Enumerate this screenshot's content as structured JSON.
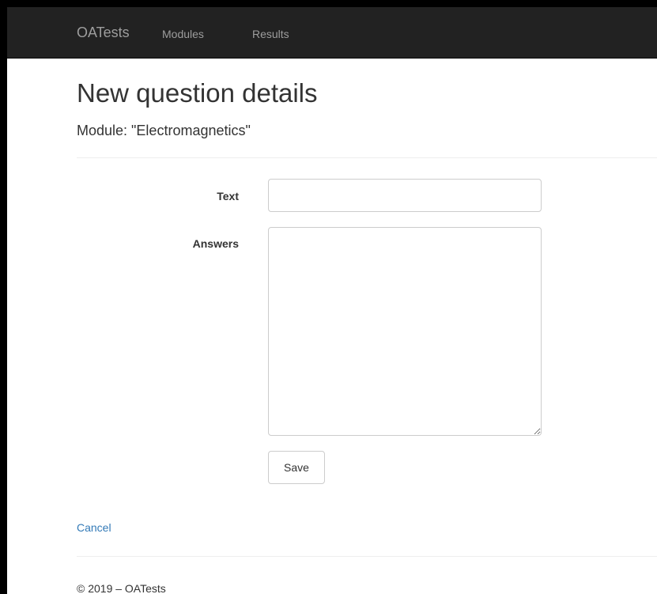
{
  "navbar": {
    "brand": "OATests",
    "links": [
      {
        "label": "Modules"
      },
      {
        "label": "Results"
      }
    ],
    "background_color": "#222222",
    "link_color": "#9d9d9d"
  },
  "page": {
    "title": "New question details",
    "subtitle": "Module: \"Electromagnetics\""
  },
  "form": {
    "text_label": "Text",
    "text_value": "",
    "answers_label": "Answers",
    "answers_value": "",
    "save_label": "Save"
  },
  "cancel_label": "Cancel",
  "footer": {
    "copyright": "© 2019 – OATests"
  },
  "colors": {
    "link": "#337ab7",
    "text": "#333333",
    "border": "#cccccc"
  }
}
